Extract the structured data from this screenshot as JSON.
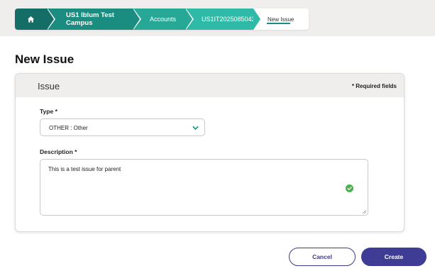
{
  "breadcrumb": {
    "home_icon": "home-icon",
    "items": [
      "US1 Iblum Test Campus",
      "Accounts",
      "US1IT2025085043",
      "New Issue"
    ]
  },
  "page": {
    "title": "New Issue"
  },
  "form": {
    "section_title": "Issue",
    "required_note": "* Required fields",
    "type_label": "Type *",
    "type_value": "OTHER : Other",
    "description_label": "Description *",
    "description_value": "This is a test issue for parent"
  },
  "actions": {
    "cancel_label": "Cancel",
    "create_label": "Create"
  },
  "colors": {
    "teal_dark": "#146d66",
    "teal": "#1b8c80",
    "accent_purple": "#3f3c96",
    "valid_green": "#4caf50"
  }
}
